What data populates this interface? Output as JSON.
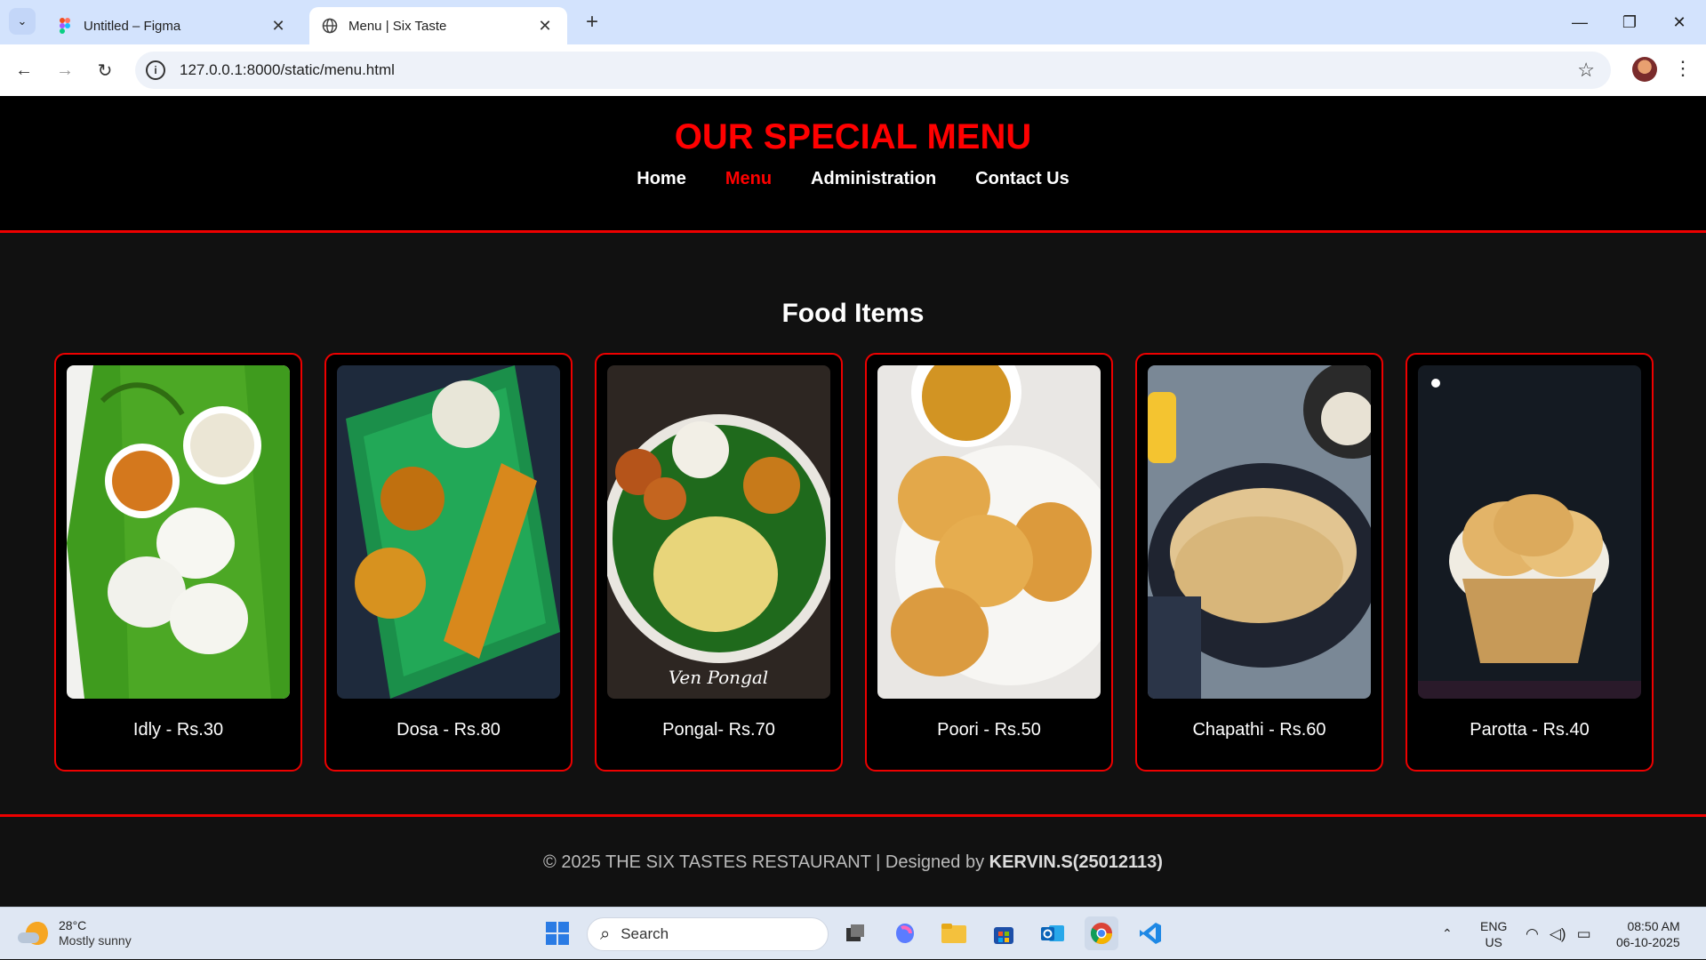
{
  "browser": {
    "tabs": [
      {
        "title": "Untitled – Figma",
        "active": false
      },
      {
        "title": "Menu | Six Taste",
        "active": true
      }
    ],
    "url": "127.0.0.1:8000/static/menu.html"
  },
  "header": {
    "title": "OUR SPECIAL MENU",
    "nav": [
      {
        "label": "Home"
      },
      {
        "label": "Menu",
        "current": true
      },
      {
        "label": "Administration"
      },
      {
        "label": "Contact Us"
      }
    ]
  },
  "section": {
    "title": "Food Items"
  },
  "items": [
    {
      "label": "Idly - Rs.30"
    },
    {
      "label": "Dosa - Rs.80"
    },
    {
      "label": "Pongal- Rs.70",
      "caption": "Ven Pongal"
    },
    {
      "label": "Poori - Rs.50"
    },
    {
      "label": "Chapathi - Rs.60"
    },
    {
      "label": "Parotta - Rs.40"
    }
  ],
  "footer": {
    "prefix": "© 2025 THE SIX TASTES RESTAURANT | Designed by ",
    "designer": "KERVIN.S(25012113)"
  },
  "taskbar": {
    "weather_temp": "28°C",
    "weather_cond": "Mostly sunny",
    "search_placeholder": "Search",
    "lang_top": "ENG",
    "lang_bottom": "US",
    "time": "08:50 AM",
    "date": "06-10-2025"
  },
  "colors": {
    "accent": "#ff0000",
    "header_bg": "#000000",
    "page_bg": "#111111"
  }
}
